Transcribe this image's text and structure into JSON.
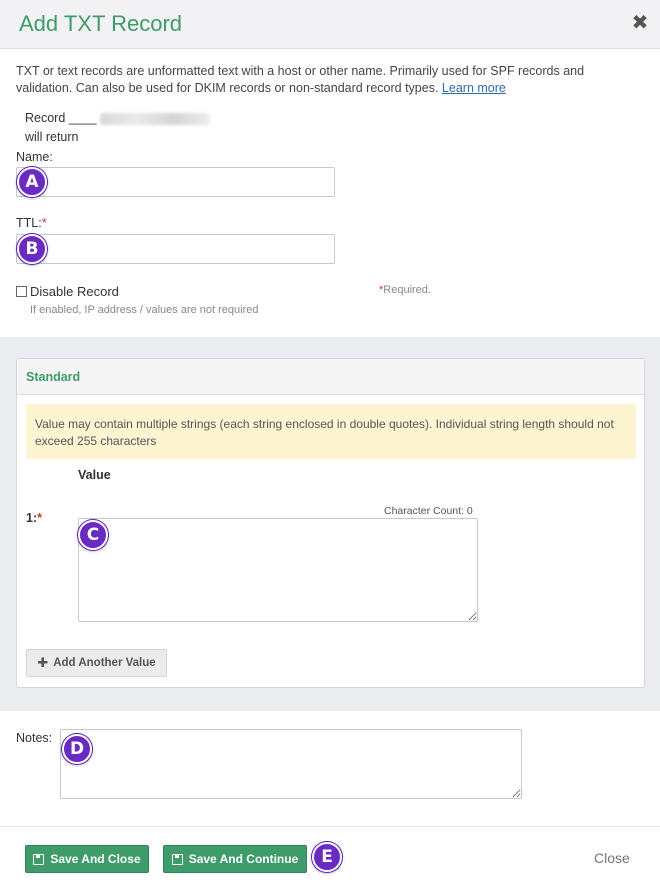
{
  "dialog": {
    "title": "Add TXT Record",
    "close_icon": "close-icon"
  },
  "intro": {
    "text": "TXT or text records are unformatted text with a host or other name. Primarily used for SPF records and validation. Can also be used for DKIM records or non-standard record types.",
    "learn_more": "Learn more"
  },
  "record_preview": {
    "prefix": "Record ____",
    "suffix": "will return"
  },
  "form": {
    "name_label": "Name:",
    "name_value": "",
    "ttl_label": "TTL:",
    "ttl_required": "*",
    "ttl_value": "",
    "disable_label": "Disable Record",
    "disable_checked": false,
    "disable_hint": "If enabled, IP address / values are not required",
    "required_star": "*",
    "required_note": "Required."
  },
  "standard_panel": {
    "title": "Standard",
    "alert": "Value may contain multiple strings (each string enclosed in double quotes). Individual string length should not exceed 255 characters",
    "value_header": "Value",
    "rows": [
      {
        "index_label": "1:",
        "required": "*",
        "char_count_label": "Character Count: 0",
        "value": ""
      }
    ],
    "add_button": "Add Another Value"
  },
  "notes": {
    "label": "Notes:",
    "value": ""
  },
  "footer": {
    "save_close": "Save And Close",
    "save_continue": "Save And Continue",
    "close": "Close"
  },
  "markers": [
    "A",
    "B",
    "C",
    "D",
    "E"
  ],
  "colors": {
    "accent_green": "#3e9b6a",
    "marker_purple": "#6a2bc2",
    "alert_bg": "#fdf4d2",
    "required_red": "#d0342c"
  }
}
